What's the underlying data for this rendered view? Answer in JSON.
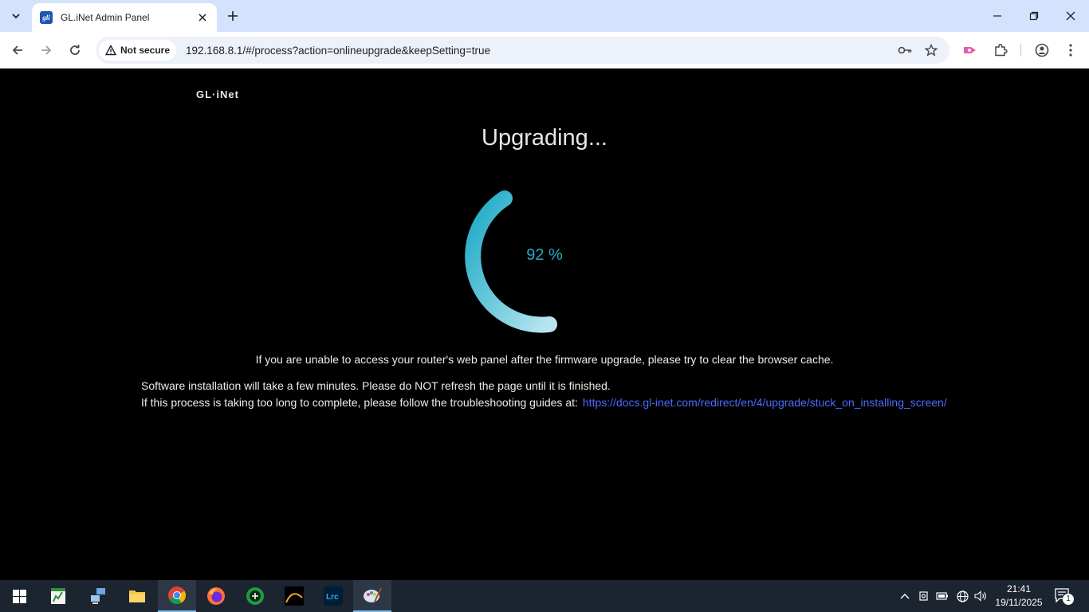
{
  "browser": {
    "tab_title": "GL.iNet Admin Panel",
    "favicon_text": "gli",
    "security_label": "Not secure",
    "url": "192.168.8.1/#/process?action=onlineupgrade&keepSetting=true"
  },
  "page": {
    "logo": "GL·iNet",
    "heading": "Upgrading...",
    "progress": 92,
    "progress_text": "92 %",
    "cache_note": "If you are unable to access your router's web panel after the firmware upgrade, please try to clear the browser cache.",
    "install_note": "Software installation will take a few minutes. Please do NOT refresh the page until it is finished.",
    "troubleshoot_note": "If this process is taking too long to complete, please follow the troubleshooting guides at:",
    "troubleshoot_link": "https://docs.gl-inet.com/redirect/en/4/upgrade/stuck_on_installing_screen/"
  },
  "colors": {
    "progress_start": "#1aa9c6",
    "progress_end": "#b8e6f0",
    "link": "#4a6bff"
  },
  "taskbar": {
    "time": "21:41",
    "date": "19/11/2025",
    "notification_count": "1"
  }
}
